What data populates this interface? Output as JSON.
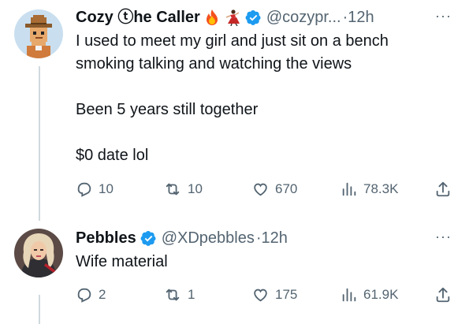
{
  "tweets": [
    {
      "name": "Cozy ⓣhe Caller",
      "handle": "@cozypr...",
      "separator": "·",
      "time": "12h",
      "text": "I used to meet my girl and just sit on a bench\nsmoking talking and watching the views\n\nBeen 5 years still together\n\n$0 date lol",
      "name_emojis": [
        "fire-emoji",
        "dancer-emoji"
      ],
      "actions": {
        "replies": "10",
        "reposts": "10",
        "likes": "670",
        "views": "78.3K"
      }
    },
    {
      "name": "Pebbles",
      "handle": "@XDpebbles",
      "separator": "·",
      "time": "12h",
      "text": "Wife material",
      "actions": {
        "replies": "2",
        "reposts": "1",
        "likes": "175",
        "views": "61.9K"
      }
    }
  ],
  "colors": {
    "text": "#0f1419",
    "secondary": "#536471",
    "verified": "#1d9bf0",
    "thread_line": "#cfd9de"
  },
  "icons": [
    "more-icon",
    "verified-badge-icon",
    "reply-icon",
    "repost-icon",
    "like-icon",
    "views-icon",
    "share-icon"
  ]
}
